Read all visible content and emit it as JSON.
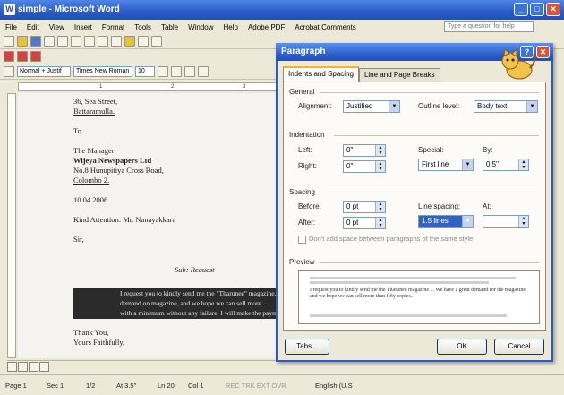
{
  "window": {
    "title": "simple - Microsoft Word"
  },
  "menu": [
    "File",
    "Edit",
    "View",
    "Insert",
    "Format",
    "Tools",
    "Table",
    "Window",
    "Help",
    "Adobe PDF",
    "Acrobat Comments"
  ],
  "help_box": {
    "placeholder": "Type a question for help"
  },
  "format_bar": {
    "style": "Normal + Justif",
    "font": "Times New Roman",
    "size": "10"
  },
  "ruler": {
    "marks": [
      "1",
      "2",
      "3"
    ]
  },
  "letter": {
    "lines_top": [
      "36, Sea Street,",
      "Battaramulla."
    ],
    "to": "To",
    "recipient": [
      "The Manager",
      "Wijeya Newspapers Ltd",
      "No.8 Hunupitiya Cross Road,",
      "Colombo 2."
    ],
    "date": "10.04.2006",
    "attention": "Kind Attention: Mr. Nanayakkara",
    "salutation": "Sir,",
    "subject": "Sub: Request",
    "body_selected": [
      "I request you to kindly send me the \"Tharunee\" magazine...",
      "demand on magazine, and we hope we can sell more...",
      "with a minimum without any failure. I will make the payment..."
    ],
    "closing": [
      "Thank You,",
      "Yours Faithfully,"
    ]
  },
  "dialog": {
    "title": "Paragraph",
    "tabs": [
      "Indents and Spacing",
      "Line and Page Breaks"
    ],
    "general": {
      "label": "General",
      "alignment_label": "Alignment:",
      "alignment_value": "Justified",
      "outline_label": "Outline level:",
      "outline_value": "Body text"
    },
    "indentation": {
      "label": "Indentation",
      "left_label": "Left:",
      "left_value": "0\"",
      "right_label": "Right:",
      "right_value": "0\"",
      "special_label": "Special:",
      "special_value": "First line",
      "by_label": "By:",
      "by_value": "0.5\""
    },
    "spacing": {
      "label": "Spacing",
      "before_label": "Before:",
      "before_value": "0 pt",
      "after_label": "After:",
      "after_value": "0 pt",
      "line_spacing_label": "Line spacing:",
      "line_spacing_value": "1.5 lines",
      "at_label": "At:",
      "at_value": "",
      "dont_add_label": "Don't add space between paragraphs of the same style"
    },
    "preview": {
      "label": "Preview",
      "text": "I request you to kindly send me the Tharunee magazine ... We have a great demand for the magazine and we hope we can sell more than fifty copies..."
    },
    "buttons": {
      "tabs": "Tabs...",
      "ok": "OK",
      "cancel": "Cancel"
    }
  },
  "status": {
    "page": "Page 1",
    "sec": "Sec 1",
    "pages": "1/2",
    "at": "At 3.5\"",
    "ln": "Ln 20",
    "col": "Col 1",
    "flags": "REC  TRK  EXT  OVR",
    "lang": "English (U.S"
  }
}
